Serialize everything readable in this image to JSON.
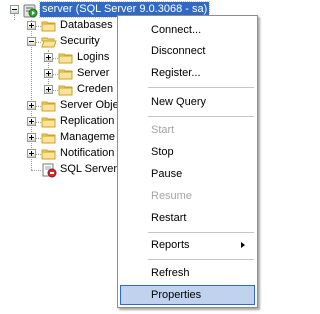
{
  "tree": {
    "server": {
      "label": "server (SQL Server 9.0.3068 - sa)",
      "icon": "sql-server-running-icon",
      "expanded": true,
      "selected": true
    },
    "databases": {
      "label": "Databases",
      "icon": "folder-icon",
      "expanded": false
    },
    "security": {
      "label": "Security",
      "icon": "folder-icon",
      "expanded": true,
      "children": {
        "logins": {
          "label": "Logins",
          "icon": "folder-icon",
          "expanded": false
        },
        "server_roles": {
          "label": "Server",
          "icon": "folder-icon",
          "expanded": false
        },
        "credentials": {
          "label": "Creden",
          "icon": "folder-icon",
          "expanded": false
        }
      }
    },
    "server_objects": {
      "label": "Server Obje",
      "icon": "folder-icon",
      "expanded": false
    },
    "replication": {
      "label": "Replication",
      "icon": "folder-icon",
      "expanded": false
    },
    "management": {
      "label": "Manageme",
      "icon": "folder-icon",
      "expanded": false
    },
    "notification": {
      "label": "Notification",
      "icon": "folder-icon",
      "expanded": false
    },
    "sql_server_agent": {
      "label": "SQL Server",
      "icon": "sql-agent-stopped-icon"
    }
  },
  "context_menu": {
    "connect": "Connect...",
    "disconnect": "Disconnect",
    "register": "Register...",
    "new_query": "New Query",
    "start": "Start",
    "stop": "Stop",
    "pause": "Pause",
    "resume": "Resume",
    "restart": "Restart",
    "reports": "Reports",
    "refresh": "Refresh",
    "properties": "Properties"
  },
  "colors": {
    "selection": "#316ac5",
    "menu_highlight": "#c1d2ee",
    "folder": "#f6d572",
    "disabled_text": "#a5a5a5"
  }
}
